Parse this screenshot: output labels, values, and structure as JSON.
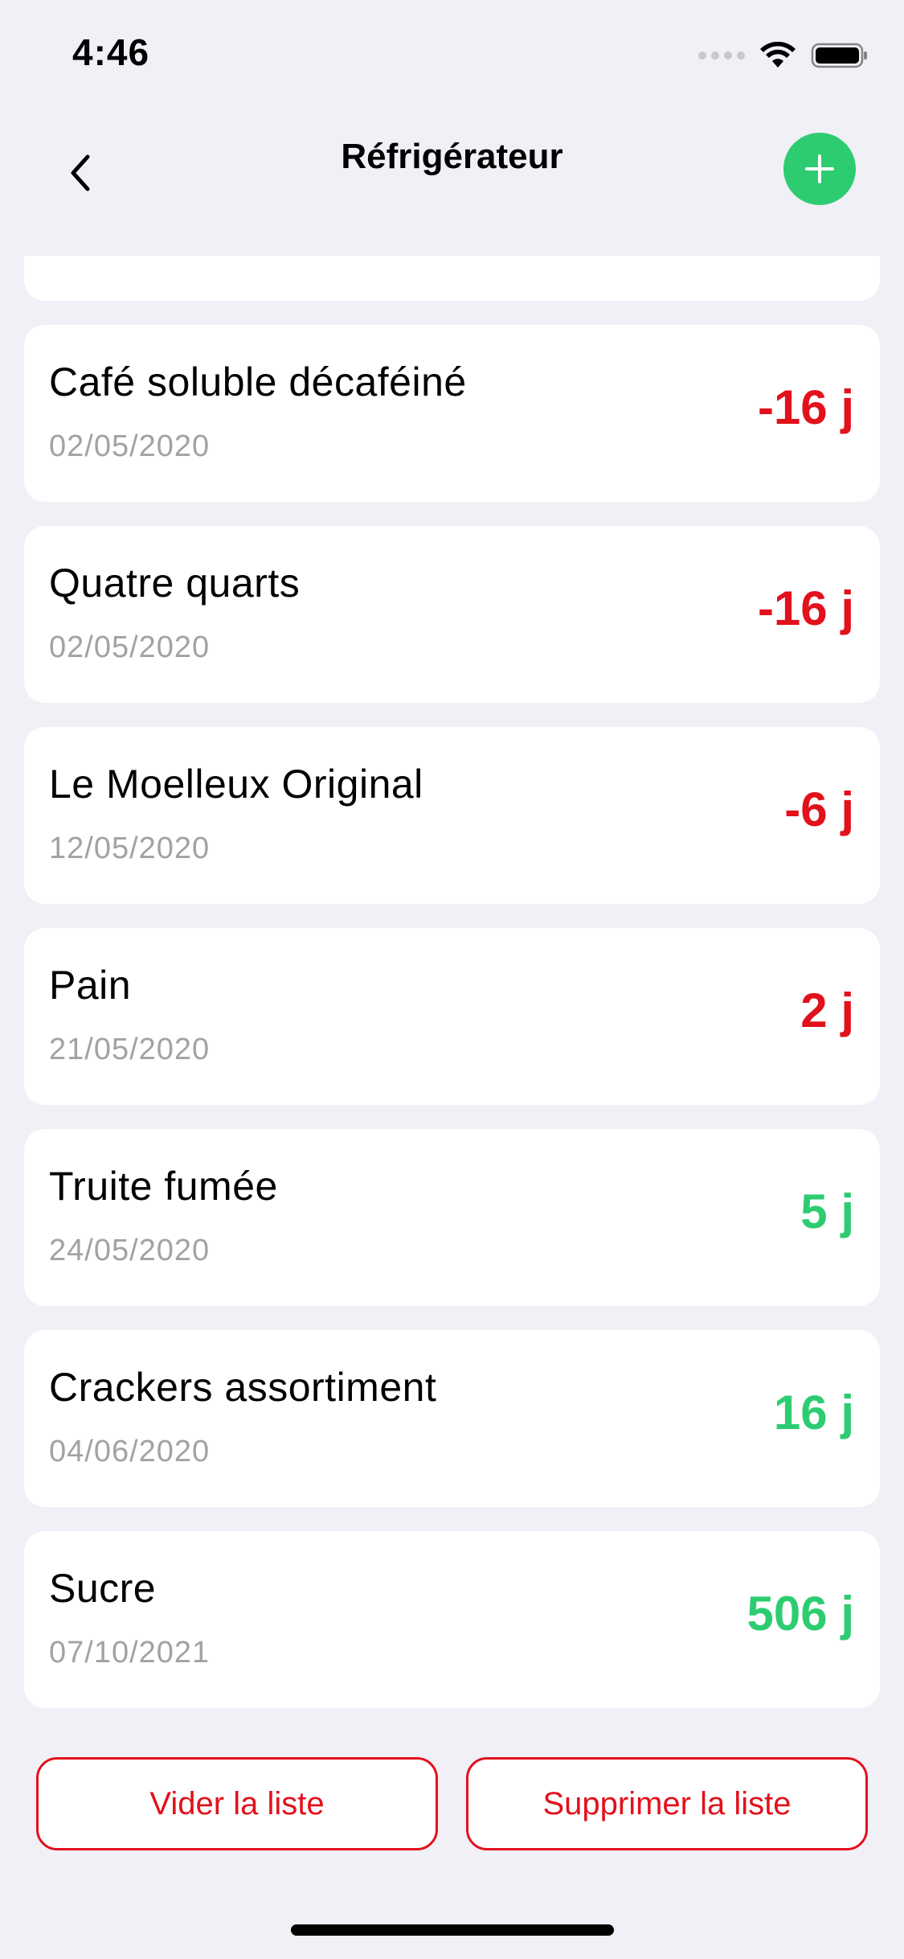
{
  "status_bar": {
    "time": "4:46"
  },
  "nav": {
    "title": "Réfrigérateur"
  },
  "items": [
    {
      "name": "Café soluble décaféiné",
      "date": "02/05/2020",
      "days": "-16 j",
      "status": "expired"
    },
    {
      "name": "Quatre quarts",
      "date": "02/05/2020",
      "days": "-16 j",
      "status": "expired"
    },
    {
      "name": "Le Moelleux Original",
      "date": "12/05/2020",
      "days": "-6 j",
      "status": "expired"
    },
    {
      "name": "Pain",
      "date": "21/05/2020",
      "days": "2 j",
      "status": "expired"
    },
    {
      "name": "Truite fumée",
      "date": "24/05/2020",
      "days": "5 j",
      "status": "ok"
    },
    {
      "name": "Crackers assortiment",
      "date": "04/06/2020",
      "days": "16 j",
      "status": "ok"
    },
    {
      "name": "Sucre",
      "date": "07/10/2021",
      "days": "506 j",
      "status": "ok"
    }
  ],
  "actions": {
    "clear_label": "Vider la liste",
    "delete_label": "Supprimer la liste"
  },
  "colors": {
    "accent_green": "#2ecc71",
    "alert_red": "#e2111c",
    "background": "#f0f0f6"
  },
  "icons": {
    "back": "chevron-left-icon",
    "add": "plus-icon",
    "wifi": "wifi-icon",
    "battery": "battery-icon",
    "signal": "signal-icon"
  }
}
